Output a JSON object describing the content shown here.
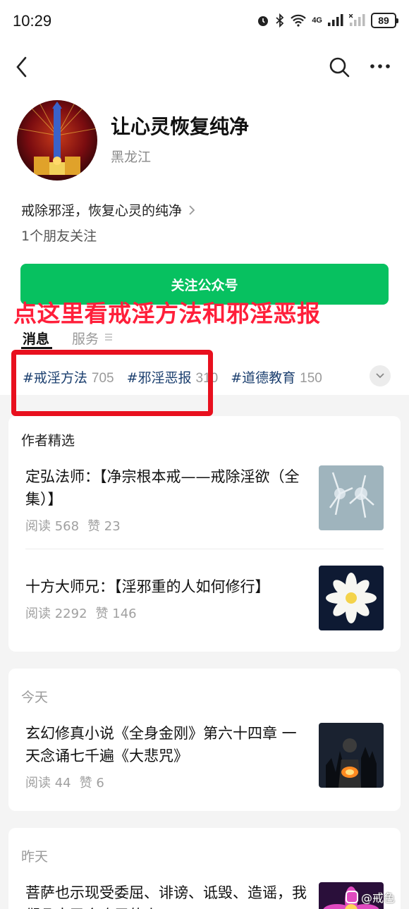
{
  "status_bar": {
    "time": "10:29",
    "network": "4G",
    "battery": "89"
  },
  "account": {
    "name": "让心灵恢复纯净",
    "location": "黑龙江",
    "description": "戒除邪淫，恢复心灵的纯净",
    "friends": "1个朋友关注",
    "follow_label": "关注公众号"
  },
  "overlay_text": "点这里看戒淫方法和邪淫恶报",
  "tabs": [
    {
      "label": "消息"
    },
    {
      "label": "服务"
    }
  ],
  "hashtags": [
    {
      "name": "#戒淫方法",
      "count": "705"
    },
    {
      "name": "#邪淫恶报",
      "count": "310"
    },
    {
      "name": "#道德教育",
      "count": "150"
    }
  ],
  "featured": {
    "title": "作者精选",
    "articles": [
      {
        "title": "定弘法师：【净宗根本戒——戒除淫欲（全集）】",
        "reads": "阅读 568",
        "likes": "赞 23"
      },
      {
        "title": "十方大师兄：【淫邪重的人如何修行】",
        "reads": "阅读 2292",
        "likes": "赞 146"
      }
    ]
  },
  "today": {
    "title": "今天",
    "articles": [
      {
        "title": "玄幻修真小说《全身金刚》第六十四章 一天念诵七千遍《大悲咒》",
        "reads": "阅读 44",
        "likes": "赞 6"
      }
    ]
  },
  "yesterday": {
    "title": "昨天",
    "articles": [
      {
        "title": "菩萨也示现受委屈、诽谤、诋毁、造谣，我们凡夫又会吃亏的人"
      }
    ]
  },
  "watermark": "@戒色"
}
